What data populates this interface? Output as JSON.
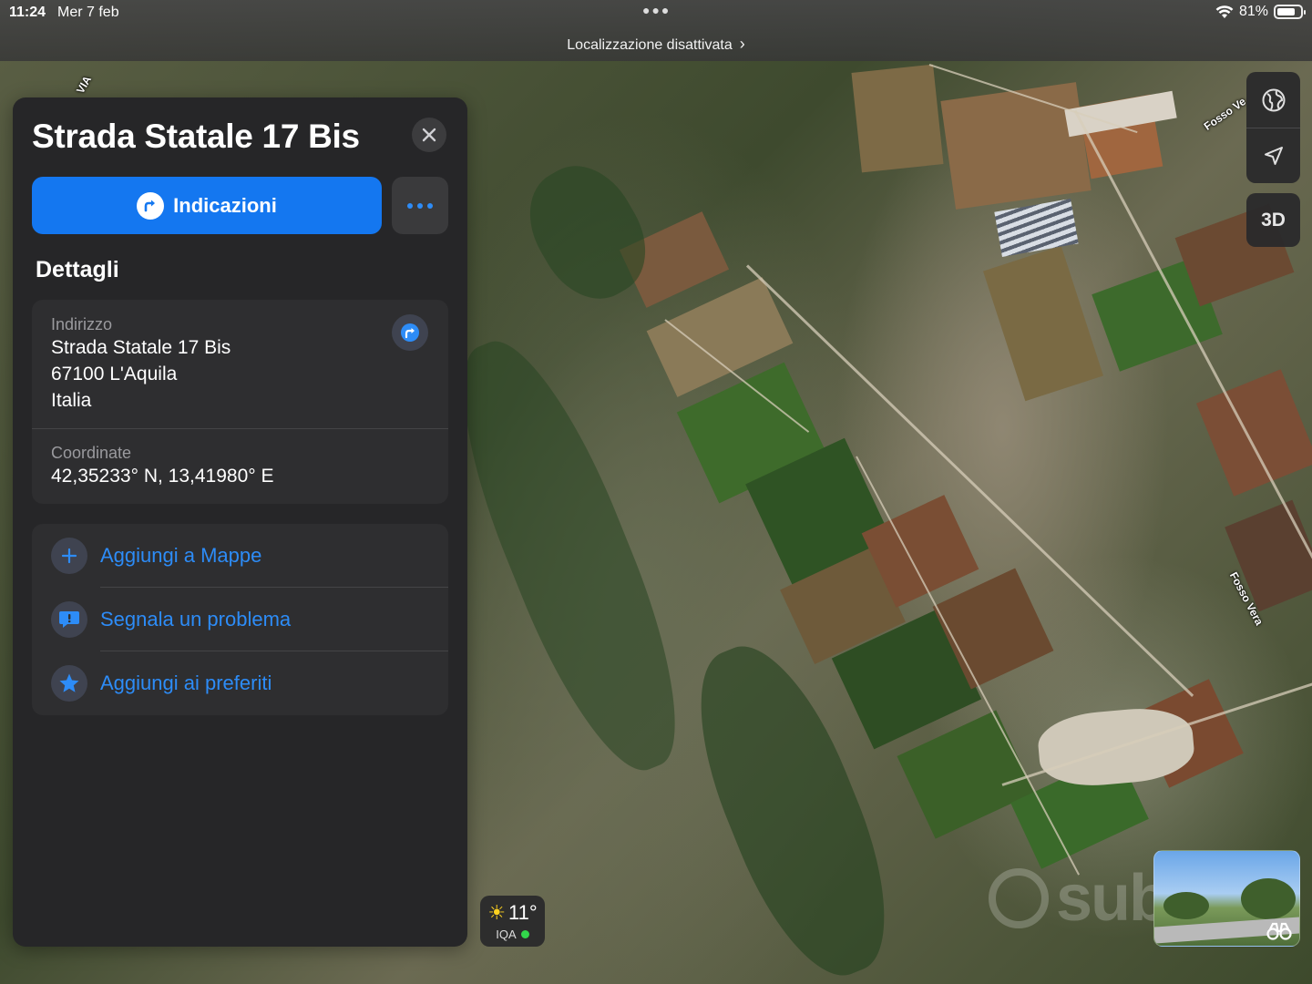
{
  "status_bar": {
    "time": "11:24",
    "date": "Mer 7 feb",
    "battery_text": "81%",
    "battery_level": 0.81,
    "location_notice": "Localizzazione disattivata"
  },
  "place": {
    "title": "Strada Statale 17 Bis",
    "directions_label": "Indicazioni",
    "section_title": "Dettagli",
    "address_label": "Indirizzo",
    "address_line1": "Strada Statale 17 Bis",
    "address_line2": "67100 L'Aquila",
    "address_line3": "Italia",
    "coordinates_label": "Coordinate",
    "coordinates_value": "42,35233° N, 13,41980° E"
  },
  "actions": [
    {
      "label": "Aggiungi a Mappe",
      "icon": "plus-icon"
    },
    {
      "label": "Segnala un problema",
      "icon": "report-icon"
    },
    {
      "label": "Aggiungi ai preferiti",
      "icon": "star-icon"
    }
  ],
  "map_controls": {
    "three_d_label": "3D"
  },
  "weather": {
    "temperature": "11°",
    "aqi_label": "IQA"
  },
  "map_labels": {
    "fosso_vera_top": "Fosso Ve",
    "fosso_vera": "Fosso Vera",
    "via": "VIA"
  },
  "watermark": {
    "text": "subito"
  },
  "colors": {
    "accent_blue": "#1477f0",
    "link_blue": "#2d8cf7",
    "panel_bg": "#262628",
    "aqi_good": "#32d74b"
  }
}
